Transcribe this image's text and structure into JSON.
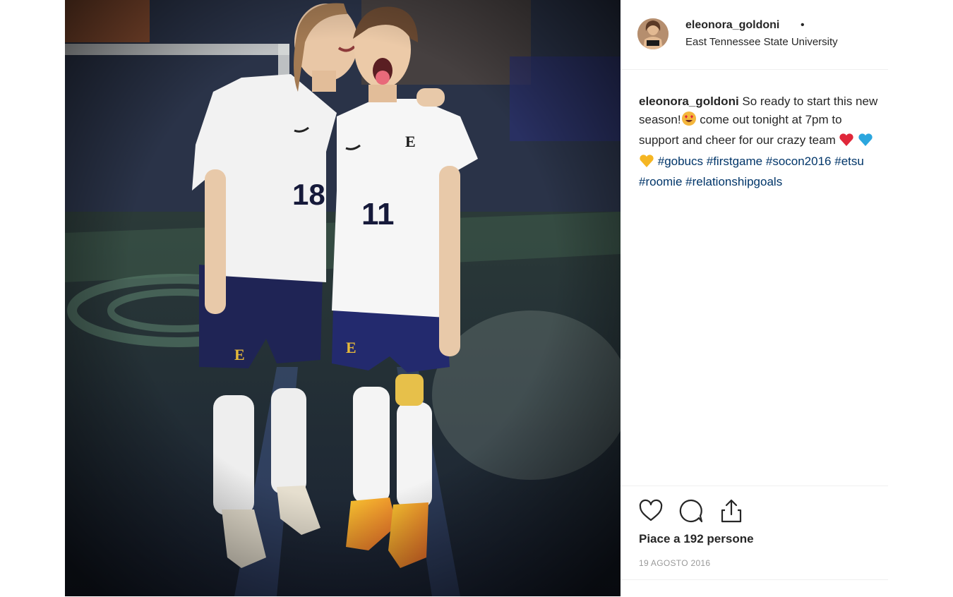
{
  "post": {
    "username": "eleonora_goldoni",
    "separator": "•",
    "location": "East Tennessee State University",
    "caption": {
      "username": "eleonora_goldoni",
      "text_1": " So ready to start this new season!",
      "text_2": " come out tonight at 7pm to support and cheer for our crazy team",
      "hashtags": [
        "#gobucs",
        "#firstgame",
        "#socon2016",
        "#etsu",
        "#roomie",
        "#relationshipgoals"
      ]
    },
    "likes_text": "Piace a 192 persone",
    "date": "19 AGOSTO 2016"
  },
  "photo": {
    "jersey_numbers": [
      "18",
      "11"
    ],
    "crest_letter": "E"
  },
  "icons": {
    "like": "heart-icon",
    "comment": "comment-icon",
    "share": "share-icon"
  },
  "colors": {
    "hashtag": "#003569",
    "muted": "#999999",
    "text": "#262626",
    "divider": "#efefef"
  }
}
